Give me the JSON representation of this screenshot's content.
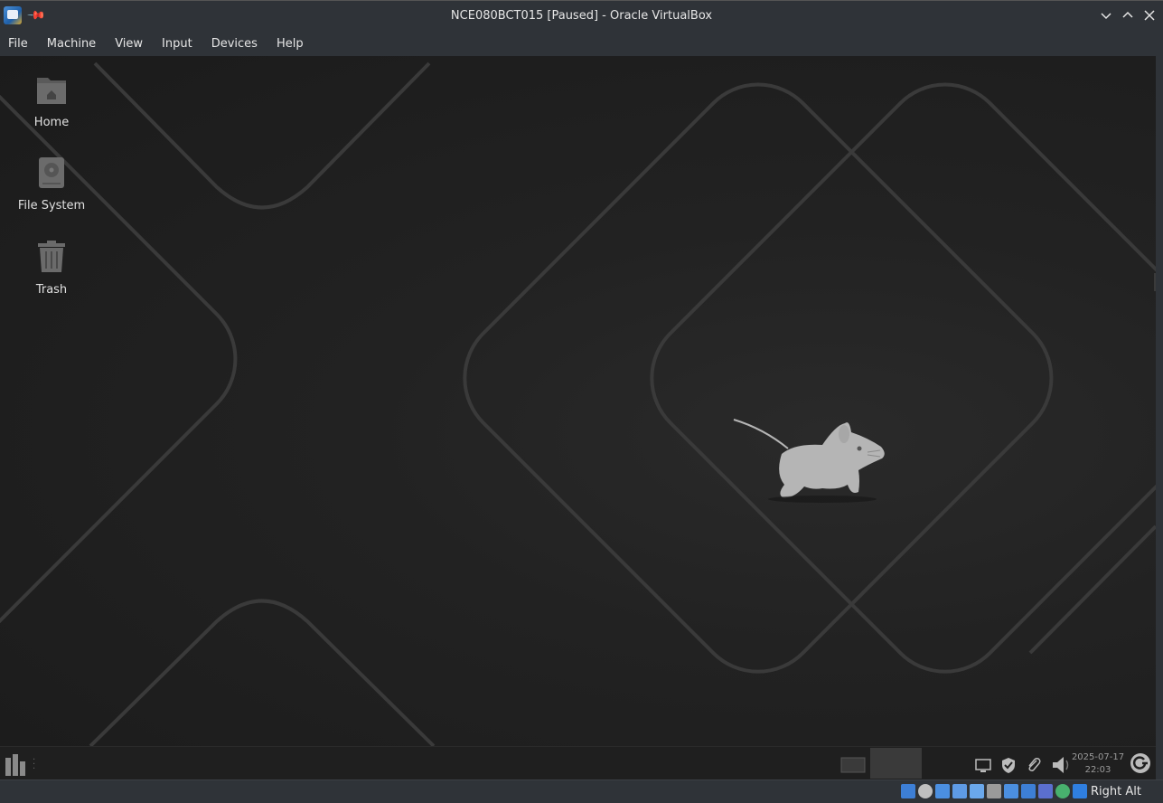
{
  "window": {
    "title": "NCE080BCT015 [Paused] - Oracle VirtualBox",
    "icons": [
      "virtualbox-app-icon",
      "pin-icon"
    ],
    "controls": [
      "minimize-icon",
      "maximize-icon",
      "close-icon"
    ]
  },
  "menu": {
    "file": "File",
    "machine": "Machine",
    "view": "View",
    "input": "Input",
    "devices": "Devices",
    "help": "Help"
  },
  "desktop": {
    "icons": [
      {
        "label": "Home",
        "icon": "home-folder-icon"
      },
      {
        "label": "File System",
        "icon": "hard-drive-icon"
      },
      {
        "label": "Trash",
        "icon": "trash-icon"
      }
    ]
  },
  "guest_panel": {
    "clock_date": "2025-07-17",
    "clock_time": "22:03",
    "tray_icons": [
      "display-icon",
      "shield-icon",
      "paperclip-icon",
      "volume-icon"
    ]
  },
  "statusbar": {
    "host_key": "Right Alt",
    "icons": [
      "hard-disk-icon",
      "optical-drive-icon",
      "audio-icon",
      "network-icon",
      "usb-icon",
      "shared-folders-icon",
      "display-icon",
      "recording-icon",
      "vt-x-icon",
      "guest-additions-icon",
      "mouse-integration-icon"
    ]
  },
  "colors": {
    "chrome": "#2f3338",
    "desktop": "#1f1f1f",
    "text": "#e6e6e6"
  }
}
